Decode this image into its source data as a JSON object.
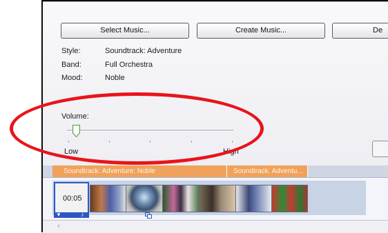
{
  "buttons": {
    "select_music": "Select Music...",
    "create_music": "Create Music...",
    "third": "De"
  },
  "info": {
    "style_label": "Style:",
    "style_value": "Soundtrack: Adventure",
    "band_label": "Band:",
    "band_value": "Full Orchestra",
    "mood_label": "Mood:",
    "mood_value": "Noble"
  },
  "volume": {
    "label": "Volume:",
    "low": "Low",
    "high": "High",
    "level": 0.05
  },
  "timeline": {
    "clip1": "Soundtrack: Adventure: Noble",
    "clip2": "Soundtrack: Adventu..."
  },
  "storyboard": {
    "selected_time": "00:05"
  },
  "colors": {
    "annotation_oval": "#e8141a",
    "music_clip": "#f0a25b",
    "selection": "#2b56c4"
  }
}
